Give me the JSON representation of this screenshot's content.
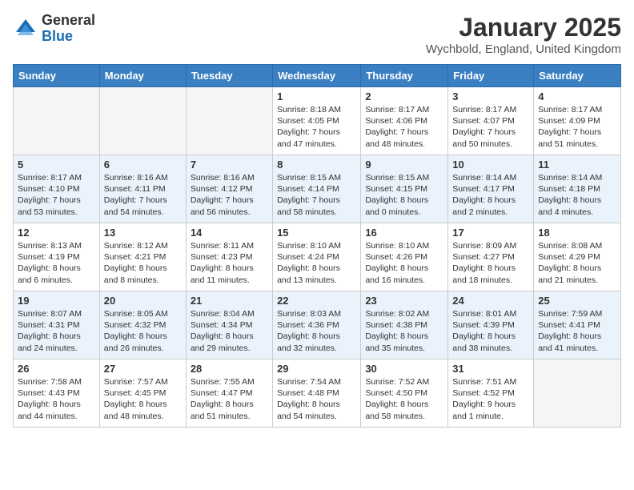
{
  "logo": {
    "general": "General",
    "blue": "Blue"
  },
  "title": "January 2025",
  "location": "Wychbold, England, United Kingdom",
  "headers": [
    "Sunday",
    "Monday",
    "Tuesday",
    "Wednesday",
    "Thursday",
    "Friday",
    "Saturday"
  ],
  "weeks": [
    {
      "alt": false,
      "days": [
        {
          "num": "",
          "info": ""
        },
        {
          "num": "",
          "info": ""
        },
        {
          "num": "",
          "info": ""
        },
        {
          "num": "1",
          "info": "Sunrise: 8:18 AM\nSunset: 4:05 PM\nDaylight: 7 hours\nand 47 minutes."
        },
        {
          "num": "2",
          "info": "Sunrise: 8:17 AM\nSunset: 4:06 PM\nDaylight: 7 hours\nand 48 minutes."
        },
        {
          "num": "3",
          "info": "Sunrise: 8:17 AM\nSunset: 4:07 PM\nDaylight: 7 hours\nand 50 minutes."
        },
        {
          "num": "4",
          "info": "Sunrise: 8:17 AM\nSunset: 4:09 PM\nDaylight: 7 hours\nand 51 minutes."
        }
      ]
    },
    {
      "alt": true,
      "days": [
        {
          "num": "5",
          "info": "Sunrise: 8:17 AM\nSunset: 4:10 PM\nDaylight: 7 hours\nand 53 minutes."
        },
        {
          "num": "6",
          "info": "Sunrise: 8:16 AM\nSunset: 4:11 PM\nDaylight: 7 hours\nand 54 minutes."
        },
        {
          "num": "7",
          "info": "Sunrise: 8:16 AM\nSunset: 4:12 PM\nDaylight: 7 hours\nand 56 minutes."
        },
        {
          "num": "8",
          "info": "Sunrise: 8:15 AM\nSunset: 4:14 PM\nDaylight: 7 hours\nand 58 minutes."
        },
        {
          "num": "9",
          "info": "Sunrise: 8:15 AM\nSunset: 4:15 PM\nDaylight: 8 hours\nand 0 minutes."
        },
        {
          "num": "10",
          "info": "Sunrise: 8:14 AM\nSunset: 4:17 PM\nDaylight: 8 hours\nand 2 minutes."
        },
        {
          "num": "11",
          "info": "Sunrise: 8:14 AM\nSunset: 4:18 PM\nDaylight: 8 hours\nand 4 minutes."
        }
      ]
    },
    {
      "alt": false,
      "days": [
        {
          "num": "12",
          "info": "Sunrise: 8:13 AM\nSunset: 4:19 PM\nDaylight: 8 hours\nand 6 minutes."
        },
        {
          "num": "13",
          "info": "Sunrise: 8:12 AM\nSunset: 4:21 PM\nDaylight: 8 hours\nand 8 minutes."
        },
        {
          "num": "14",
          "info": "Sunrise: 8:11 AM\nSunset: 4:23 PM\nDaylight: 8 hours\nand 11 minutes."
        },
        {
          "num": "15",
          "info": "Sunrise: 8:10 AM\nSunset: 4:24 PM\nDaylight: 8 hours\nand 13 minutes."
        },
        {
          "num": "16",
          "info": "Sunrise: 8:10 AM\nSunset: 4:26 PM\nDaylight: 8 hours\nand 16 minutes."
        },
        {
          "num": "17",
          "info": "Sunrise: 8:09 AM\nSunset: 4:27 PM\nDaylight: 8 hours\nand 18 minutes."
        },
        {
          "num": "18",
          "info": "Sunrise: 8:08 AM\nSunset: 4:29 PM\nDaylight: 8 hours\nand 21 minutes."
        }
      ]
    },
    {
      "alt": true,
      "days": [
        {
          "num": "19",
          "info": "Sunrise: 8:07 AM\nSunset: 4:31 PM\nDaylight: 8 hours\nand 24 minutes."
        },
        {
          "num": "20",
          "info": "Sunrise: 8:05 AM\nSunset: 4:32 PM\nDaylight: 8 hours\nand 26 minutes."
        },
        {
          "num": "21",
          "info": "Sunrise: 8:04 AM\nSunset: 4:34 PM\nDaylight: 8 hours\nand 29 minutes."
        },
        {
          "num": "22",
          "info": "Sunrise: 8:03 AM\nSunset: 4:36 PM\nDaylight: 8 hours\nand 32 minutes."
        },
        {
          "num": "23",
          "info": "Sunrise: 8:02 AM\nSunset: 4:38 PM\nDaylight: 8 hours\nand 35 minutes."
        },
        {
          "num": "24",
          "info": "Sunrise: 8:01 AM\nSunset: 4:39 PM\nDaylight: 8 hours\nand 38 minutes."
        },
        {
          "num": "25",
          "info": "Sunrise: 7:59 AM\nSunset: 4:41 PM\nDaylight: 8 hours\nand 41 minutes."
        }
      ]
    },
    {
      "alt": false,
      "days": [
        {
          "num": "26",
          "info": "Sunrise: 7:58 AM\nSunset: 4:43 PM\nDaylight: 8 hours\nand 44 minutes."
        },
        {
          "num": "27",
          "info": "Sunrise: 7:57 AM\nSunset: 4:45 PM\nDaylight: 8 hours\nand 48 minutes."
        },
        {
          "num": "28",
          "info": "Sunrise: 7:55 AM\nSunset: 4:47 PM\nDaylight: 8 hours\nand 51 minutes."
        },
        {
          "num": "29",
          "info": "Sunrise: 7:54 AM\nSunset: 4:48 PM\nDaylight: 8 hours\nand 54 minutes."
        },
        {
          "num": "30",
          "info": "Sunrise: 7:52 AM\nSunset: 4:50 PM\nDaylight: 8 hours\nand 58 minutes."
        },
        {
          "num": "31",
          "info": "Sunrise: 7:51 AM\nSunset: 4:52 PM\nDaylight: 9 hours\nand 1 minute."
        },
        {
          "num": "",
          "info": ""
        }
      ]
    }
  ]
}
